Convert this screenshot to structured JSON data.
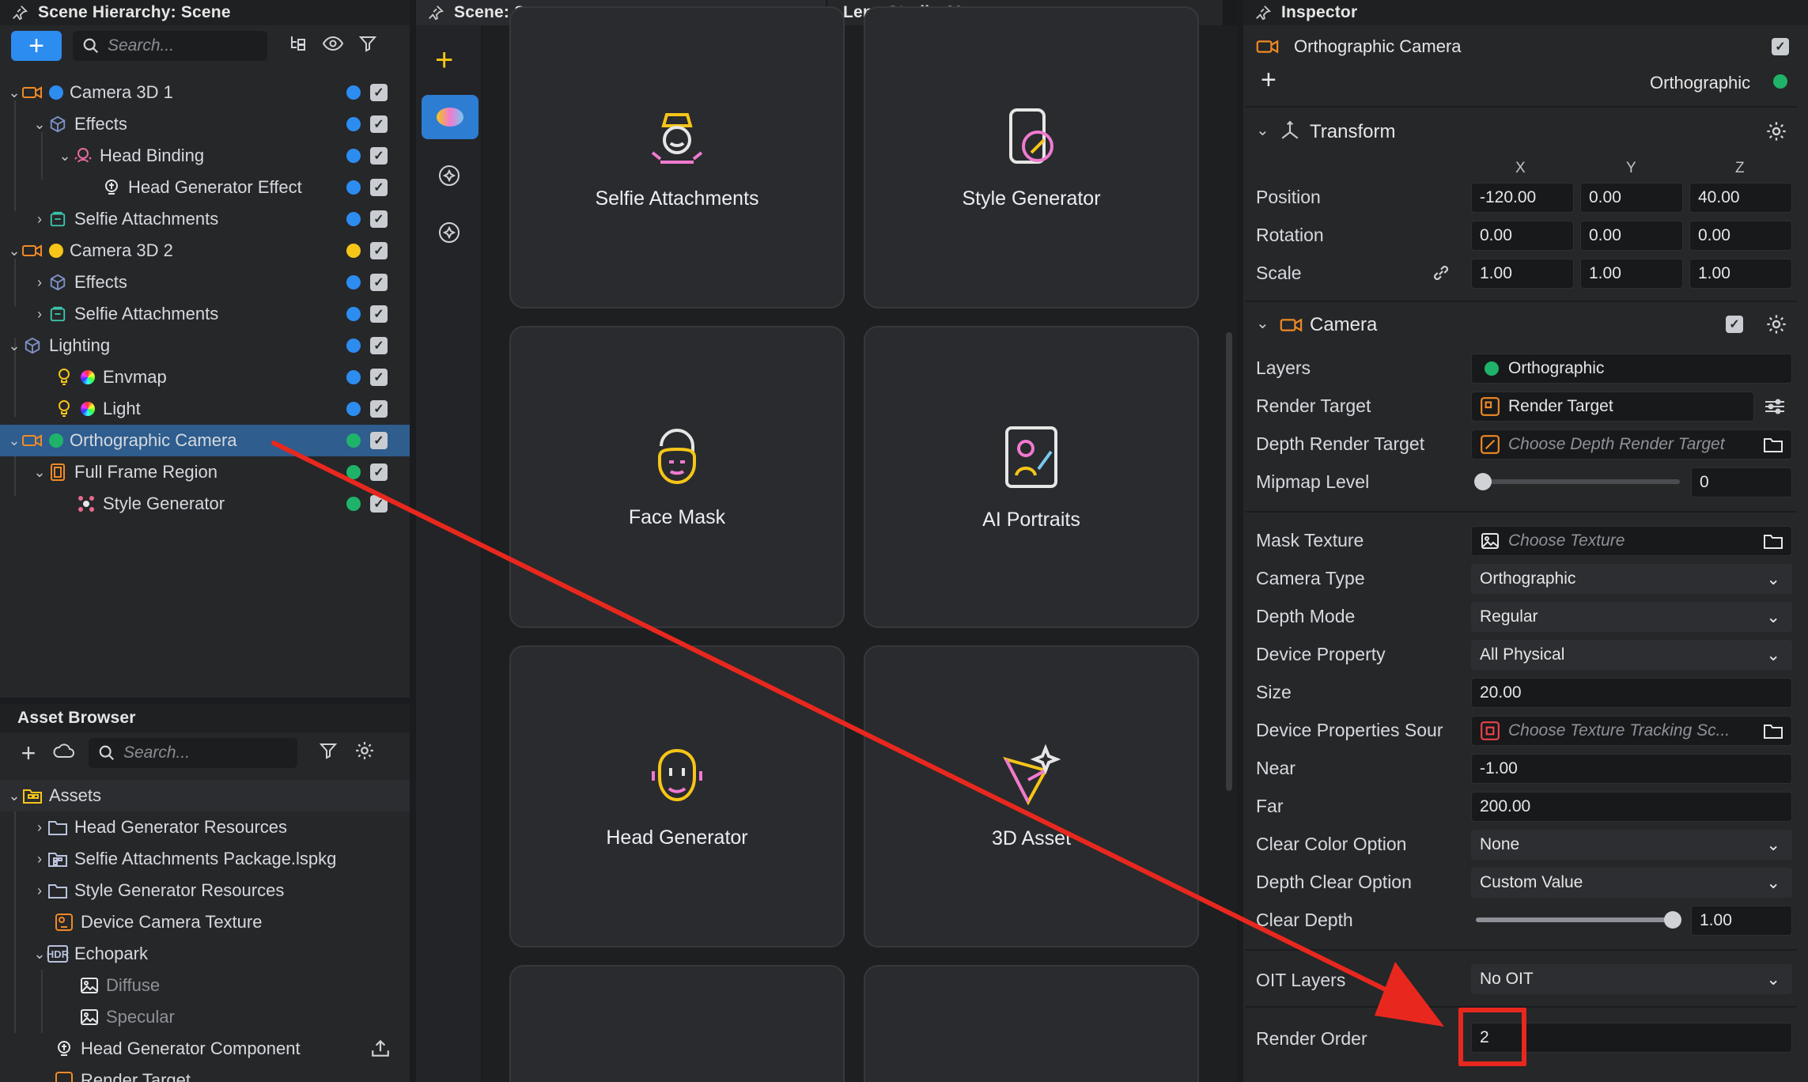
{
  "hierarchy": {
    "title": "Scene Hierarchy: Scene",
    "add_label": "+",
    "search_placeholder": "Search...",
    "rows": [
      {
        "label": "Camera 3D 1",
        "dot": "#2d8cf0"
      },
      {
        "label": "Effects"
      },
      {
        "label": "Head Binding"
      },
      {
        "label": "Head Generator Effect"
      },
      {
        "label": "Selfie Attachments"
      },
      {
        "label": "Camera 3D 2",
        "dot": "#f5c518"
      },
      {
        "label": "Effects"
      },
      {
        "label": "Selfie Attachments"
      },
      {
        "label": "Lighting"
      },
      {
        "label": "Envmap"
      },
      {
        "label": "Light"
      },
      {
        "label": "Orthographic Camera",
        "dot": "#1fb36a"
      },
      {
        "label": "Full Frame Region"
      },
      {
        "label": "Style Generator"
      }
    ]
  },
  "assets": {
    "title": "Asset Browser",
    "search_placeholder": "Search...",
    "rows": [
      {
        "label": "Assets"
      },
      {
        "label": "Head Generator Resources"
      },
      {
        "label": "Selfie Attachments Package.lspkg"
      },
      {
        "label": "Style Generator Resources"
      },
      {
        "label": "Device Camera Texture"
      },
      {
        "label": "Echopark"
      },
      {
        "label": "Diffuse"
      },
      {
        "label": "Specular"
      },
      {
        "label": "Head Generator Component"
      },
      {
        "label": "Render Target"
      }
    ]
  },
  "scene": {
    "tab_scene": "Scene: Scene",
    "tab_ai": "Lens Studio AI",
    "cards": [
      {
        "label": "Selfie Attachments"
      },
      {
        "label": "Style Generator"
      },
      {
        "label": "Face Mask"
      },
      {
        "label": "AI Portraits"
      },
      {
        "label": "Head Generator"
      },
      {
        "label": "3D Asset"
      }
    ]
  },
  "inspector": {
    "title": "Inspector",
    "object_name": "Orthographic Camera",
    "layer_name": "Orthographic",
    "transform": {
      "title": "Transform",
      "axis_x": "X",
      "axis_y": "Y",
      "axis_z": "Z",
      "position_label": "Position",
      "position": [
        "-120.00",
        "0.00",
        "40.00"
      ],
      "rotation_label": "Rotation",
      "rotation": [
        "0.00",
        "0.00",
        "0.00"
      ],
      "scale_label": "Scale",
      "scale": [
        "1.00",
        "1.00",
        "1.00"
      ]
    },
    "camera": {
      "title": "Camera",
      "layers_label": "Layers",
      "layers_value": "Orthographic",
      "render_target_label": "Render Target",
      "render_target_value": "Render Target",
      "depth_rt_label": "Depth Render Target",
      "depth_rt_placeholder": "Choose Depth Render Target",
      "mipmap_label": "Mipmap Level",
      "mipmap_value": "0",
      "mask_label": "Mask Texture",
      "mask_placeholder": "Choose Texture",
      "camera_type_label": "Camera Type",
      "camera_type_value": "Orthographic",
      "depth_mode_label": "Depth Mode",
      "depth_mode_value": "Regular",
      "device_prop_label": "Device Property",
      "device_prop_value": "All Physical",
      "size_label": "Size",
      "size_value": "20.00",
      "device_src_label": "Device Properties Sour",
      "device_src_placeholder": "Choose Texture Tracking Sc...",
      "near_label": "Near",
      "near_value": "-1.00",
      "far_label": "Far",
      "far_value": "200.00",
      "clear_color_label": "Clear Color Option",
      "clear_color_value": "None",
      "depth_clear_label": "Depth Clear Option",
      "depth_clear_value": "Custom Value",
      "clear_depth_label": "Clear Depth",
      "clear_depth_value": "1.00",
      "oit_label": "OIT Layers",
      "oit_value": "No OIT",
      "render_order_label": "Render Order",
      "render_order_value": "2"
    }
  },
  "colors": {
    "accent": "#2d8cf0",
    "annotation": "#e8281e",
    "selected_row": "#2e5d8e"
  }
}
